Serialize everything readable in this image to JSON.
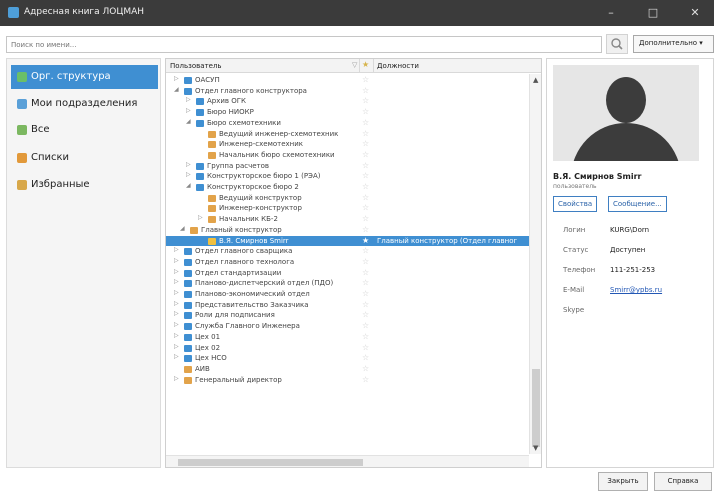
{
  "window": {
    "title": "Адресная книга ЛОЦМАН",
    "minimize": "–",
    "maximize": "□",
    "close": "✕"
  },
  "search": {
    "placeholder": "Поиск по имени...",
    "more_label": "Дополнительно ▾"
  },
  "sidebar": {
    "items": [
      {
        "label": "Орг. структура",
        "icon": "org-structure-icon",
        "color": "#6abf69",
        "active": true
      },
      {
        "label": "Мои подразделения",
        "icon": "my-departments-icon",
        "color": "#5aa0d8"
      },
      {
        "label": "Все",
        "icon": "all-users-icon",
        "color": "#7cb861"
      },
      {
        "label": "Списки",
        "icon": "lists-icon",
        "color": "#e2993a"
      },
      {
        "label": "Избранные",
        "icon": "favorites-icon",
        "color": "#d8a84a"
      }
    ]
  },
  "tree": {
    "headers": {
      "user": "Пользователь",
      "position": "Должности"
    },
    "rows": [
      {
        "label": "ОАСУП",
        "level": 1,
        "expander": "▷",
        "icon": "group"
      },
      {
        "label": "Отдел главного конструктора",
        "level": 1,
        "expander": "◢",
        "icon": "group"
      },
      {
        "label": "Архив ОГК",
        "level": 2,
        "expander": "▷",
        "icon": "group"
      },
      {
        "label": "Бюро НИОКР",
        "level": 2,
        "expander": "▷",
        "icon": "group"
      },
      {
        "label": "Бюро схемотехники",
        "level": 2,
        "expander": "◢",
        "icon": "group"
      },
      {
        "label": "Ведущий инженер-схемотехник",
        "level": 3,
        "expander": "",
        "icon": "position"
      },
      {
        "label": "Инженер-схемотехник",
        "level": 3,
        "expander": "",
        "icon": "position"
      },
      {
        "label": "Начальник бюро схемотехники",
        "level": 3,
        "expander": "",
        "icon": "position"
      },
      {
        "label": "Группа расчетов",
        "level": 2,
        "expander": "▷",
        "icon": "group"
      },
      {
        "label": "Конструкторское бюро 1 (РЭА)",
        "level": 2,
        "expander": "▷",
        "icon": "group"
      },
      {
        "label": "Конструкторское бюро 2",
        "level": 2,
        "expander": "◢",
        "icon": "group"
      },
      {
        "label": "Ведущий конструктор",
        "level": 3,
        "expander": "",
        "icon": "position"
      },
      {
        "label": "Инженер-конструктор",
        "level": 3,
        "expander": "",
        "icon": "position"
      },
      {
        "label": "Начальник КБ-2",
        "level": 3,
        "expander": "▷",
        "icon": "position"
      },
      {
        "label": "Главный конструктор",
        "level": 1.5,
        "expander": "◢",
        "icon": "position"
      },
      {
        "label": "В.Я. Смирнов   Smirr",
        "level": 3,
        "expander": "",
        "icon": "user",
        "selected": true,
        "position": "Главный конструктор (Отдел главног"
      },
      {
        "label": "Отдел главного сварщика",
        "level": 1,
        "expander": "▷",
        "icon": "group"
      },
      {
        "label": "Отдел главного технолога",
        "level": 1,
        "expander": "▷",
        "icon": "group"
      },
      {
        "label": "Отдел стандартизации",
        "level": 1,
        "expander": "▷",
        "icon": "group"
      },
      {
        "label": "Планово-диспетчерский отдел (ПДО)",
        "level": 1,
        "expander": "▷",
        "icon": "group"
      },
      {
        "label": "Планово-экономический отдел",
        "level": 1,
        "expander": "▷",
        "icon": "group"
      },
      {
        "label": "Представительство Заказчика",
        "level": 1,
        "expander": "▷",
        "icon": "group"
      },
      {
        "label": "Роли для подписания",
        "level": 1,
        "expander": "▷",
        "icon": "group"
      },
      {
        "label": "Служба Главного Инженера",
        "level": 1,
        "expander": "▷",
        "icon": "group"
      },
      {
        "label": "Цех 01",
        "level": 1,
        "expander": "▷",
        "icon": "group"
      },
      {
        "label": "Цех 02",
        "level": 1,
        "expander": "▷",
        "icon": "group"
      },
      {
        "label": "Цех НСО",
        "level": 1,
        "expander": "▷",
        "icon": "group"
      },
      {
        "label": "АИВ",
        "level": 1,
        "expander": "",
        "icon": "position"
      },
      {
        "label": "Генеральный директор",
        "level": 1,
        "expander": "▷",
        "icon": "position"
      }
    ]
  },
  "card": {
    "name": "В.Я. Смирнов    Smirr",
    "role": "пользователь",
    "tabs": {
      "properties": "Свойства",
      "message": "Сообщение..."
    },
    "fields": [
      {
        "label": "Логин",
        "value": "KURG\\Dorn"
      },
      {
        "label": "Статус",
        "value": "Доступен"
      },
      {
        "label": "Телефон",
        "value": "111-251-253"
      },
      {
        "label": "E-Mail",
        "value": "Smirr@ypbs.ru",
        "link": true
      },
      {
        "label": "Skype",
        "value": ""
      }
    ]
  },
  "footer": {
    "close": "Закрыть",
    "help": "Справка"
  },
  "colors": {
    "accent": "#3f8fd2",
    "titlebar": "#3b3b3b",
    "group_icon": "#3f8fd2",
    "position_icon": "#e2a34a",
    "user_icon": "#f0c040"
  }
}
